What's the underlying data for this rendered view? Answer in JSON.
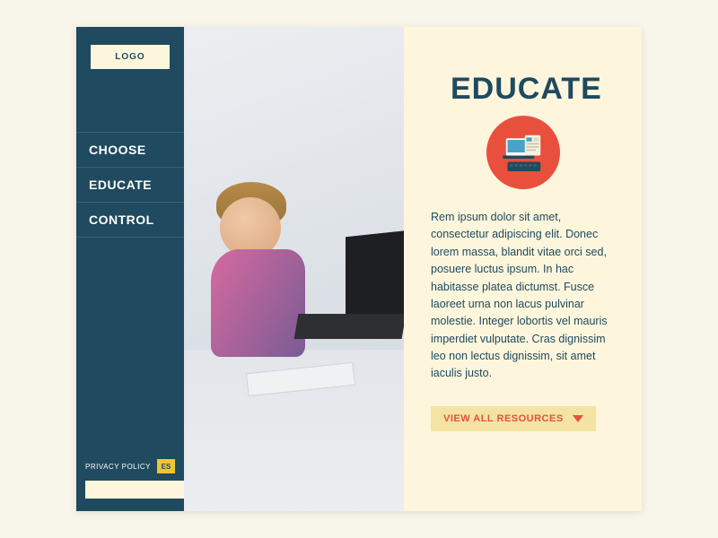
{
  "sidebar": {
    "logo": "LOGO",
    "nav": [
      {
        "label": "CHOOSE"
      },
      {
        "label": "EDUCATE"
      },
      {
        "label": "CONTROL"
      }
    ],
    "privacy_label": "PRIVACY POLICY",
    "language_label": "ES",
    "search": {
      "value": "",
      "placeholder": ""
    }
  },
  "content": {
    "title": "EDUCATE",
    "body": "Rem ipsum dolor sit amet, consectetur adipiscing elit. Donec lorem massa, blandit vitae orci sed, posuere luctus ipsum. In hac habitasse platea dictumst. Fusce laoreet urna non lacus pulvinar molestie. Integer lobortis vel mauris imperdiet vulputate. Cras dignissim leo non lectus dignissim, sit amet iaculis justo.",
    "cta_label": "VIEW ALL RESOURCES"
  },
  "colors": {
    "accent_red": "#e94f3d",
    "sidebar_bg": "#1f4a5f",
    "page_bg": "#fdf6dc",
    "yellow": "#f4c430",
    "teal": "#4aa3c4"
  }
}
